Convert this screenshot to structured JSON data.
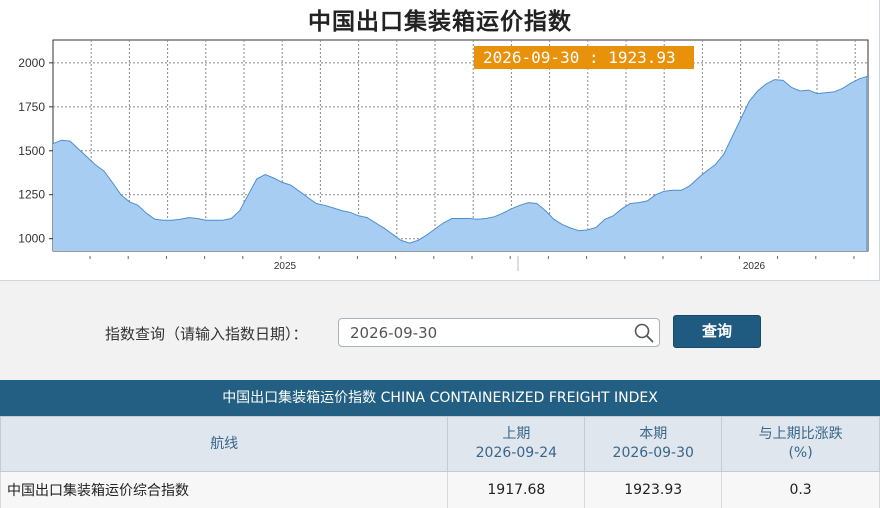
{
  "chart": {
    "title": "中国出口集装箱运价指数",
    "tooltip": "2026-09-30 : 1923.93",
    "y_ticks": [
      "2000",
      "1750",
      "1500",
      "1250",
      "1000"
    ],
    "x_ticks": [
      "2025",
      "2026"
    ]
  },
  "chart_data": {
    "type": "area",
    "title": "中国出口集装箱运价指数",
    "xlabel": "",
    "ylabel": "",
    "x_tick_labels": [
      "2025",
      "2026"
    ],
    "ylim": [
      930,
      2130
    ],
    "y_ticks": [
      1000,
      1250,
      1500,
      1750,
      2000
    ],
    "grid": true,
    "series": [
      {
        "values": [
          1540,
          1560,
          1555,
          1510,
          1465,
          1420,
          1385,
          1320,
          1250,
          1210,
          1190,
          1145,
          1110,
          1105,
          1105,
          1110,
          1120,
          1115,
          1105,
          1105,
          1105,
          1115,
          1160,
          1250,
          1340,
          1365,
          1345,
          1320,
          1305,
          1270,
          1235,
          1200,
          1190,
          1175,
          1160,
          1150,
          1130,
          1120,
          1090,
          1060,
          1025,
          990,
          975,
          990,
          1020,
          1055,
          1090,
          1115,
          1115,
          1115,
          1110,
          1115,
          1125,
          1145,
          1170,
          1190,
          1205,
          1200,
          1160,
          1110,
          1080,
          1060,
          1045,
          1050,
          1065,
          1110,
          1130,
          1170,
          1200,
          1205,
          1215,
          1250,
          1270,
          1275,
          1275,
          1300,
          1345,
          1385,
          1420,
          1480,
          1580,
          1680,
          1780,
          1840,
          1880,
          1905,
          1900,
          1860,
          1840,
          1845,
          1825,
          1830,
          1835,
          1855,
          1885,
          1910,
          1924
        ]
      }
    ]
  },
  "query": {
    "label": "指数查询（请输入指数日期）：",
    "value": "2026-09-30",
    "button": "查询"
  },
  "table": {
    "title": "中国出口集装箱运价指数 CHINA CONTAINERIZED FREIGHT INDEX",
    "headers": {
      "route": "航线",
      "prev_label": "上期",
      "prev_date": "2026-09-24",
      "curr_label": "本期",
      "curr_date": "2026-09-30",
      "change_label": "与上期比涨跌",
      "change_unit": "(%)"
    },
    "rows": [
      {
        "route": "中国出口集装箱运价综合指数",
        "prev": "1917.68",
        "curr": "1923.93",
        "change": "0.3"
      }
    ]
  },
  "colors": {
    "area_fill": "#a8cdf2",
    "area_line": "#4d8fd0",
    "tooltip_bg": "#e8910a",
    "header_bar": "#235f82",
    "button": "#1f5b80"
  }
}
